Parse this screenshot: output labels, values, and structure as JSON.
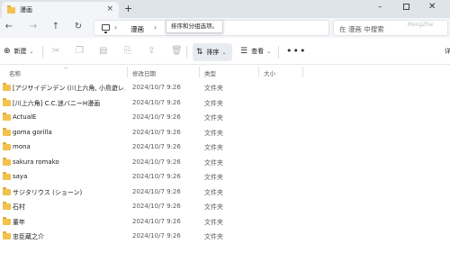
{
  "window": {
    "tab_title": "漫画",
    "close_tab": "×",
    "new_tab": "+",
    "minimize": "–",
    "close": "✕"
  },
  "nav": {
    "back": "←",
    "forward": "→",
    "up": "↑",
    "refresh": "↻",
    "breadcrumb": [
      "漫画"
    ],
    "chevron": "›",
    "tooltip": "排序和分组选项。",
    "search_placeholder": "在 漫画 中搜索",
    "watermark": "MengZhe"
  },
  "toolbar": {
    "new_label": "新建",
    "sort_label": "排序",
    "view_label": "查看",
    "more": "•••",
    "right_edge": "详"
  },
  "columns": {
    "name": "名称",
    "modified": "修改日期",
    "type": "类型",
    "size": "大小"
  },
  "files": [
    {
      "name": "[アジサイデンデン (川上六角, 小鳥遊レ...",
      "modified": "2024/10/7 9:26",
      "type": "文件夹"
    },
    {
      "name": "[川上六角] C.C.迷バニーH漫画",
      "modified": "2024/10/7 9:26",
      "type": "文件夹"
    },
    {
      "name": "ActualE",
      "modified": "2024/10/7 9:26",
      "type": "文件夹"
    },
    {
      "name": "goma gorilla",
      "modified": "2024/10/7 9:26",
      "type": "文件夹"
    },
    {
      "name": "mona",
      "modified": "2024/10/7 9:26",
      "type": "文件夹"
    },
    {
      "name": "sakura romako",
      "modified": "2024/10/7 9:26",
      "type": "文件夹"
    },
    {
      "name": "saya",
      "modified": "2024/10/7 9:26",
      "type": "文件夹"
    },
    {
      "name": "サジタリウス (ショーン)",
      "modified": "2024/10/7 9:26",
      "type": "文件夹"
    },
    {
      "name": "石村",
      "modified": "2024/10/7 9:26",
      "type": "文件夹"
    },
    {
      "name": "董年",
      "modified": "2024/10/7 9:26",
      "type": "文件夹"
    },
    {
      "name": "忠臣蔵之介",
      "modified": "2024/10/7 9:26",
      "type": "文件夹"
    }
  ],
  "colors": {
    "folder": "#f2c14e",
    "tab_active": "#f3f5f8",
    "titlebar": "#dfe4ea",
    "sort_button_bg": "#e8ecf1"
  },
  "icons": {
    "folder": "folder-icon",
    "new": "plus-circle-icon",
    "cut": "scissors-icon",
    "copy": "copy-icon",
    "paste": "paste-icon",
    "rename": "rename-icon",
    "share": "share-icon",
    "delete": "trash-icon",
    "sort": "sort-icon",
    "view": "view-icon"
  }
}
